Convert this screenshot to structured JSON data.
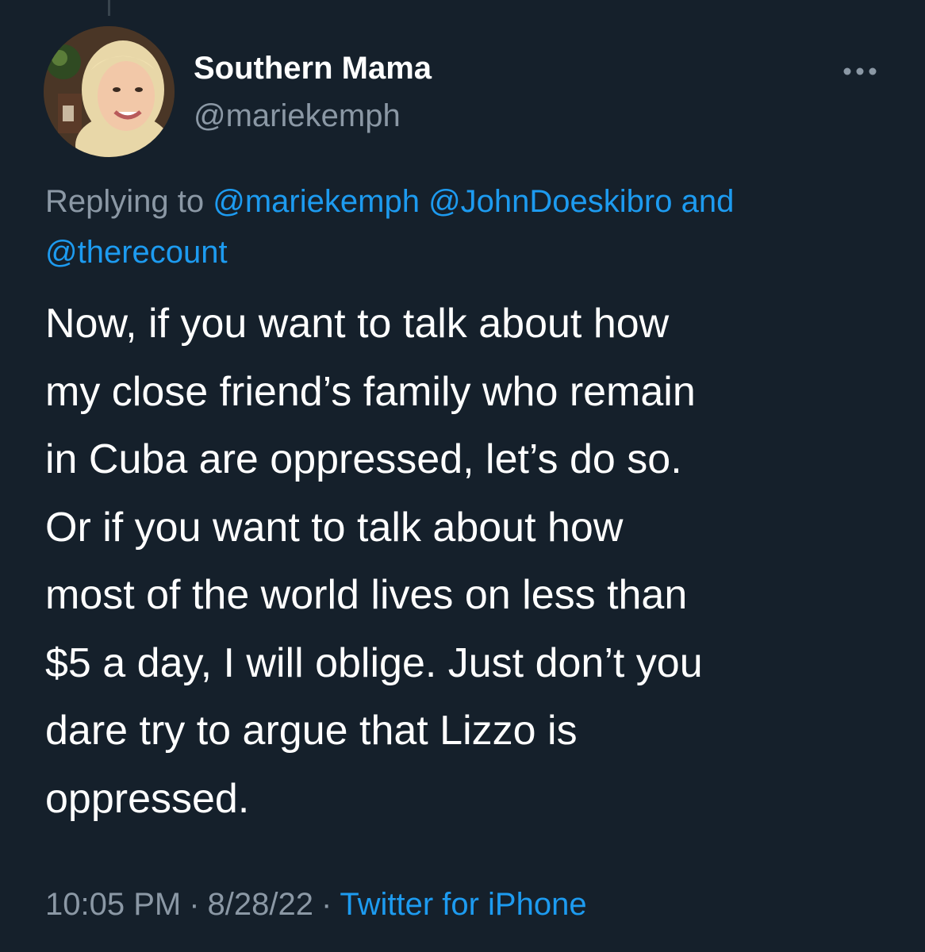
{
  "author": {
    "display_name": "Southern Mama",
    "handle": "@mariekemph",
    "avatar_icon": "user-photo-avatar"
  },
  "more_icon": "more-dots-icon",
  "reply_context": {
    "prefix": "Replying to",
    "mentions": [
      "@mariekemph",
      "@JohnDoeskibro",
      "@therecount"
    ],
    "conjunction": "and"
  },
  "tweet": {
    "lines": [
      "Now, if you want to talk about how",
      "my close friend’s family who remain",
      "in Cuba are oppressed, let’s do so.",
      "Or if you want to talk about how",
      "most of the world lives on less than",
      "$5 a day, I will oblige. Just don’t you",
      "dare try to argue that Lizzo is",
      "oppressed."
    ]
  },
  "meta": {
    "time": "10:05 PM",
    "date": "8/28/22",
    "separator": "·",
    "source": "Twitter for iPhone"
  },
  "colors": {
    "background": "#15202b",
    "text": "#ffffff",
    "secondary": "#8b98a5",
    "link": "#1d9bf0"
  }
}
